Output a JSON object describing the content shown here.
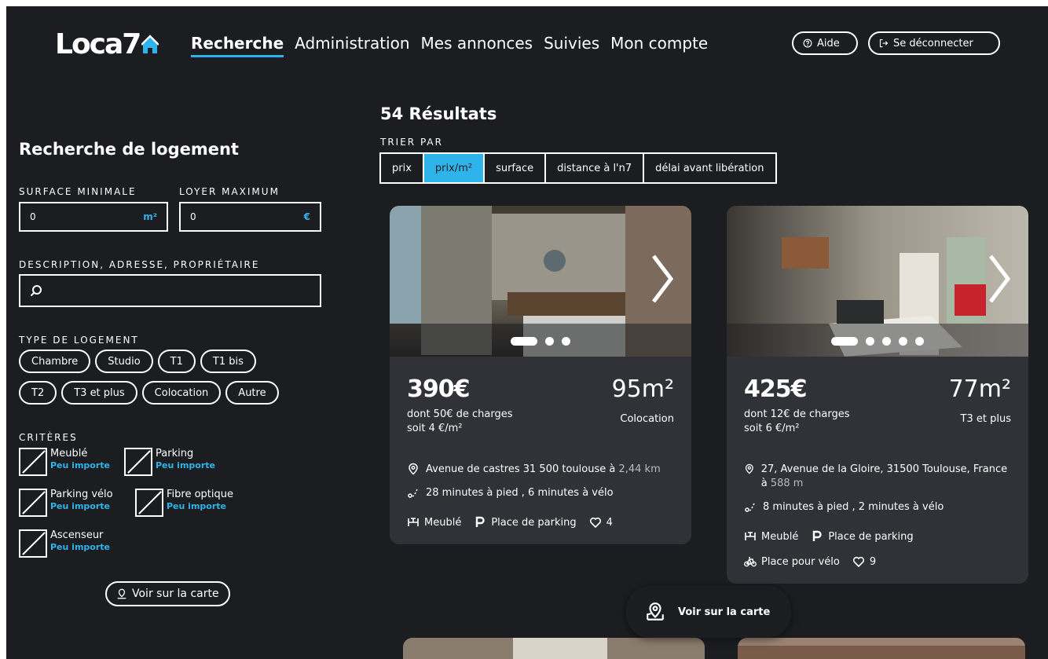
{
  "app": {
    "logo": "Loca7"
  },
  "nav": {
    "items": [
      {
        "label": "Recherche",
        "active": true
      },
      {
        "label": "Administration"
      },
      {
        "label": "Mes annonces"
      },
      {
        "label": "Suivies"
      },
      {
        "label": "Mon compte"
      }
    ],
    "help_label": "Aide",
    "logout_label": "Se déconnecter"
  },
  "sidebar": {
    "title": "Recherche de logement",
    "surface_label": "SURFACE MINIMALE",
    "surface_value": "0",
    "surface_unit": "m²",
    "rent_label": "LOYER MAXIMUM",
    "rent_value": "0",
    "rent_unit": "€",
    "desc_label": "DESCRIPTION, ADRESSE, PROPRIÉTAIRE",
    "desc_value": "",
    "type_label": "TYPE DE LOGEMENT",
    "types": [
      "Chambre",
      "Studio",
      "T1",
      "T1 bis",
      "T2",
      "T3 et plus",
      "Colocation",
      "Autre"
    ],
    "criteria_label": "CRITÈRES",
    "criteria": [
      {
        "label": "Meublé",
        "value": "Peu importe"
      },
      {
        "label": "Parking",
        "value": "Peu importe"
      },
      {
        "label": "Parking vélo",
        "value": "Peu importe"
      },
      {
        "label": "Fibre optique",
        "value": "Peu importe"
      },
      {
        "label": "Ascenseur",
        "value": "Peu importe"
      }
    ],
    "map_button": "Voir sur la carte"
  },
  "results": {
    "title": "54 Résultats",
    "sort_label": "TRIER PAR",
    "sort_options": [
      "prix",
      "prix/m²",
      "surface",
      "distance à l'n7",
      "délai avant libération"
    ],
    "sort_active": "prix/m²",
    "cards": [
      {
        "price": "390€",
        "surface": "95m²",
        "charges": "dont 50€ de charges",
        "per_m2": "soit 4 €/m²",
        "type": "Colocation",
        "address": "Avenue de castres 31 500 toulouse",
        "address_connector": " à ",
        "distance": "2,44 km",
        "travel": "28 minutes à pied , 6 minutes à vélo",
        "features": [
          "Meublé",
          "Place de parking"
        ],
        "likes": "4",
        "photo_count": 3
      },
      {
        "price": "425€",
        "surface": "77m²",
        "charges": "dont 12€ de charges",
        "per_m2": "soit 6 €/m²",
        "type": "T3 et plus",
        "address": "27, Avenue de la Gloire, 31500 Toulouse, France",
        "address_connector": " à ",
        "distance": "588 m",
        "travel": "8 minutes à pied , 2 minutes à vélo",
        "features": [
          "Meublé",
          "Place de parking",
          "Place pour vélo"
        ],
        "likes": "9",
        "photo_count": 5
      }
    ]
  },
  "floating_map_button": "Voir sur la carte",
  "colors": {
    "background": "#1c1d20",
    "card": "#303237",
    "accent": "#2eb3ea"
  }
}
